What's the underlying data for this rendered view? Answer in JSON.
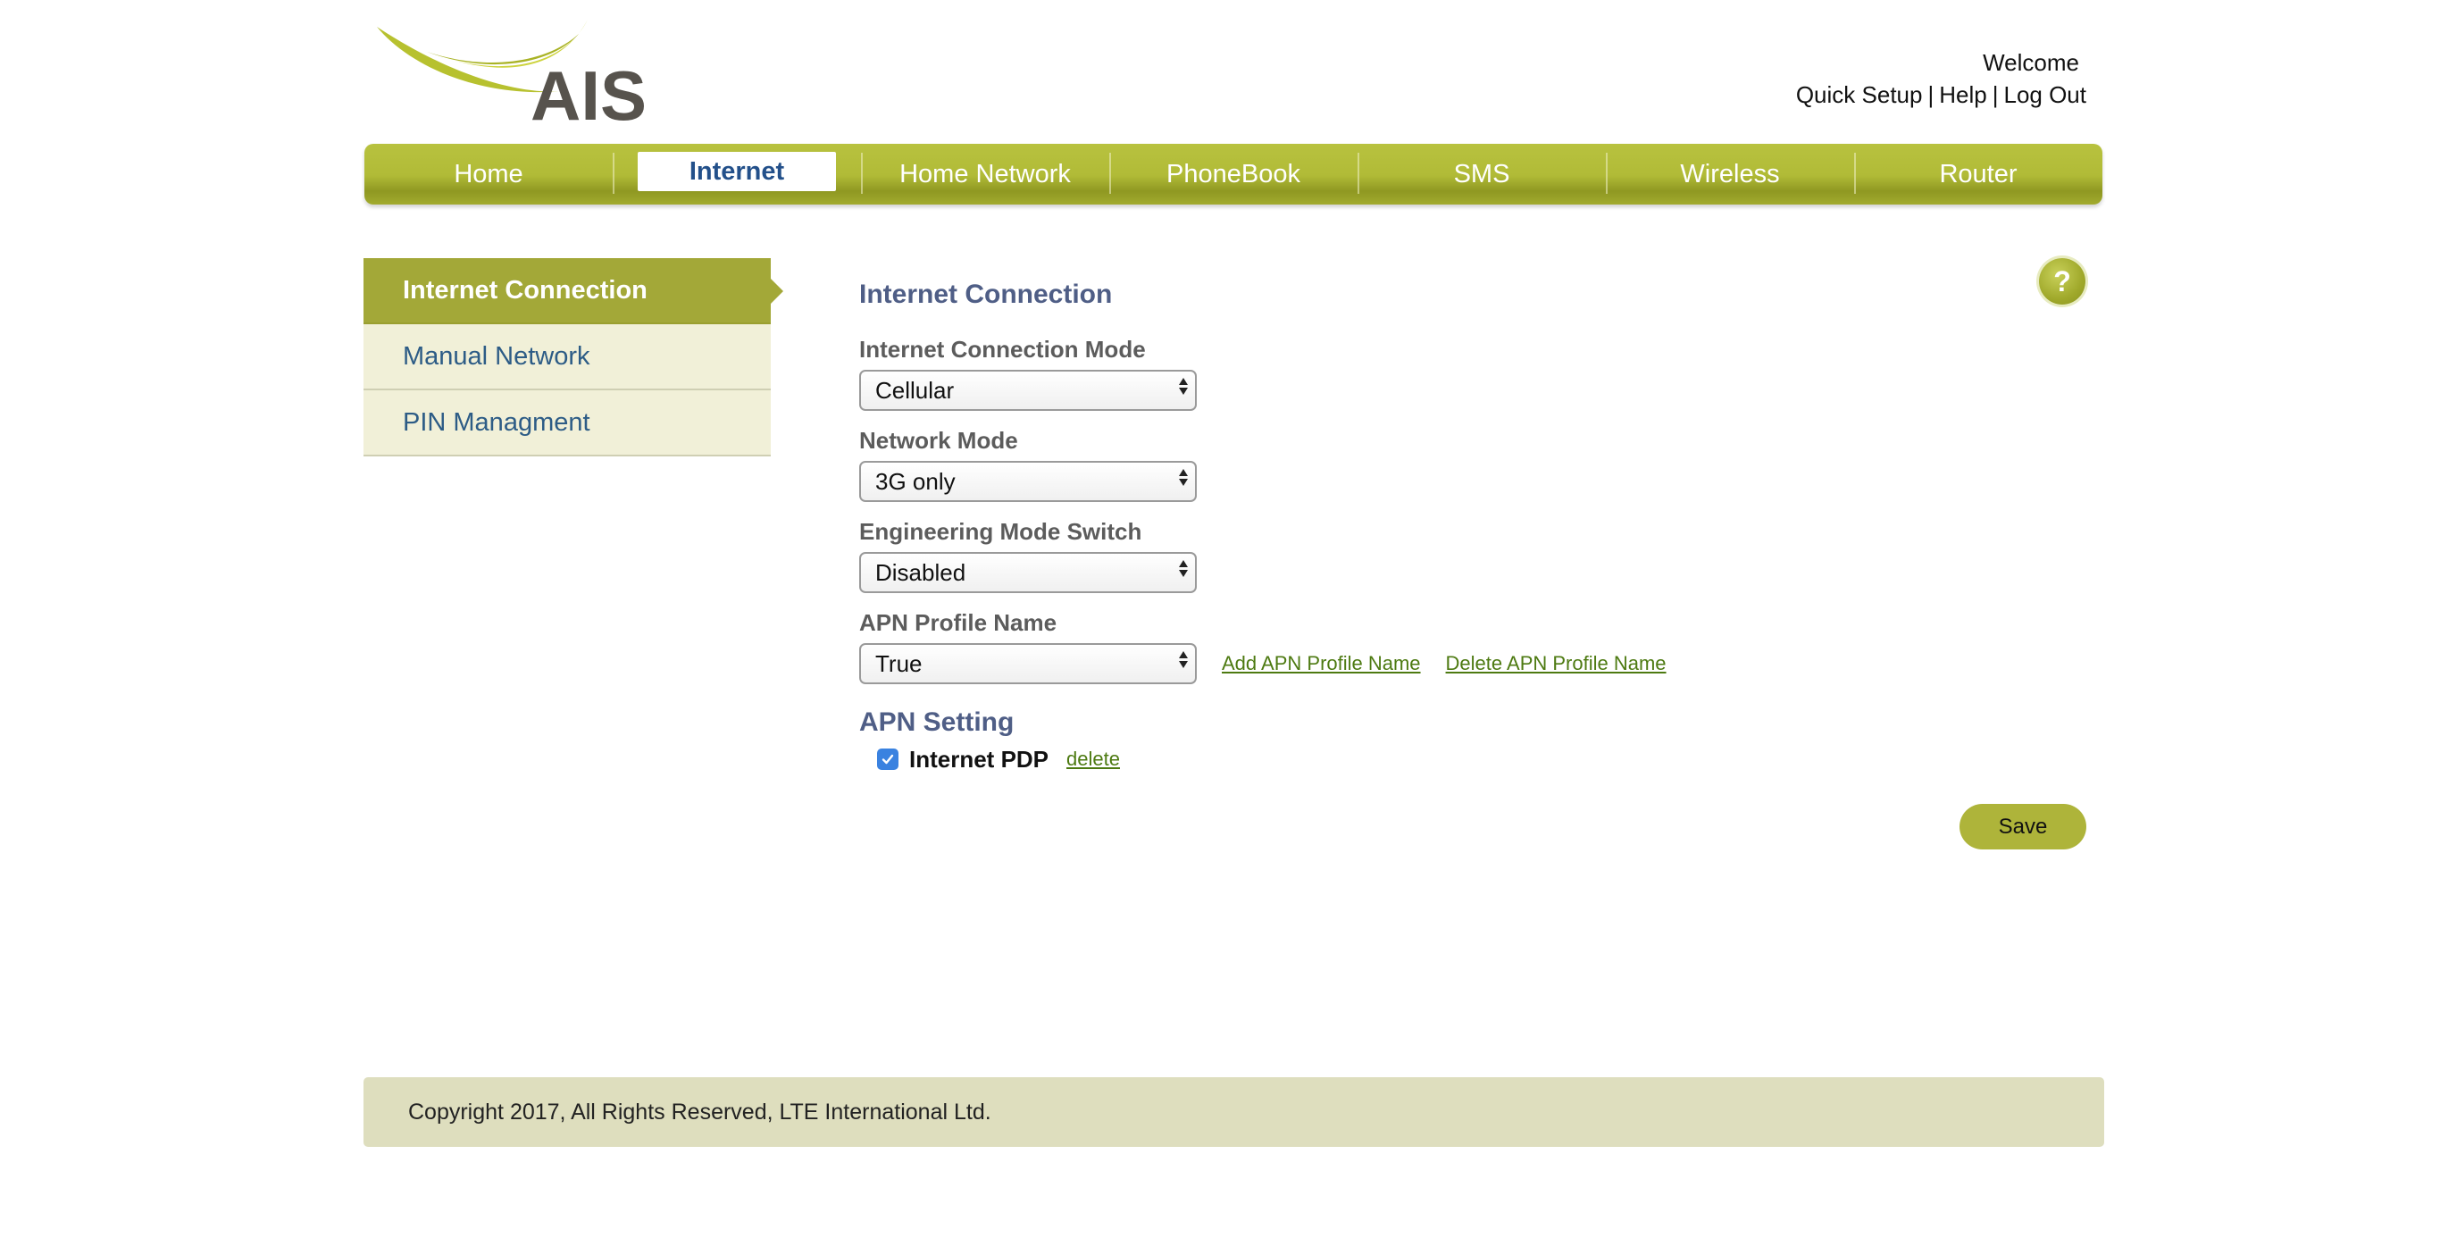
{
  "brand": {
    "logo_text": "AIS",
    "accent_color": "#a3a838",
    "link_color": "#4d7a11"
  },
  "header": {
    "welcome": "Welcome",
    "links": {
      "quick_setup": "Quick Setup",
      "help": "Help",
      "logout": "Log Out",
      "separator": "|"
    }
  },
  "nav": {
    "items": [
      {
        "label": "Home",
        "active": false
      },
      {
        "label": "Internet",
        "active": true
      },
      {
        "label": "Home Network",
        "active": false
      },
      {
        "label": "PhoneBook",
        "active": false
      },
      {
        "label": "SMS",
        "active": false
      },
      {
        "label": "Wireless",
        "active": false
      },
      {
        "label": "Router",
        "active": false
      }
    ]
  },
  "sidebar": {
    "items": [
      {
        "label": "Internet Connection",
        "active": true
      },
      {
        "label": "Manual Network",
        "active": false
      },
      {
        "label": "PIN Managment",
        "active": false
      }
    ]
  },
  "main": {
    "title": "Internet Connection",
    "help_icon": "?",
    "fields": {
      "connection_mode": {
        "label": "Internet Connection Mode",
        "value": "Cellular"
      },
      "network_mode": {
        "label": "Network Mode",
        "value": "3G only"
      },
      "engineering_mode": {
        "label": "Engineering Mode Switch",
        "value": "Disabled"
      },
      "apn_profile": {
        "label": "APN Profile Name",
        "value": "True",
        "add_link": "Add APN Profile Name",
        "delete_link": "Delete APN Profile Name"
      }
    },
    "apn_setting": {
      "title": "APN Setting",
      "pdp_label": "Internet PDP",
      "pdp_checked": true,
      "delete_link": "delete"
    },
    "save_label": "Save"
  },
  "footer": {
    "copyright": "Copyright 2017, All Rights Reserved, LTE International Ltd."
  }
}
